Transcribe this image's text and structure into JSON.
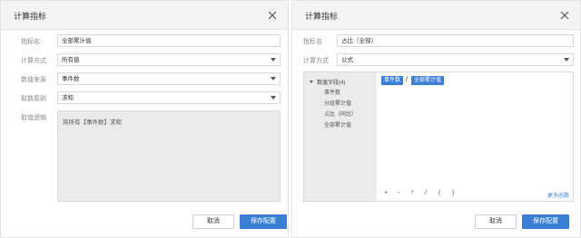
{
  "left_dialog": {
    "title": "计算指标",
    "labels": {
      "name": "指标名",
      "method": "计算方式",
      "source": "数值来源",
      "rule": "取数原则",
      "logic": "取值逻辑"
    },
    "values": {
      "name": "全部累计值",
      "method": "所有值",
      "source": "事件数",
      "rule": "求和"
    },
    "logic_text": "将所有【事件数】求和",
    "buttons": {
      "cancel": "取消",
      "save": "保存配置"
    }
  },
  "right_dialog": {
    "title": "计算指标",
    "labels": {
      "name": "指标名",
      "method": "计算方式"
    },
    "values": {
      "name": "占比（全部）",
      "method": "公式"
    },
    "tree": {
      "root": "数值字段(4)",
      "items": [
        "事件数",
        "分组累计值",
        "占比（同比）",
        "全部累计值"
      ]
    },
    "formula": {
      "token_a": "事件数",
      "operator": "/",
      "token_b": "全部累计值"
    },
    "operators": [
      "+",
      "-",
      "*",
      "/",
      "(",
      ")"
    ],
    "more_functions": "更多函数",
    "buttons": {
      "cancel": "取消",
      "save": "保存配置"
    }
  }
}
